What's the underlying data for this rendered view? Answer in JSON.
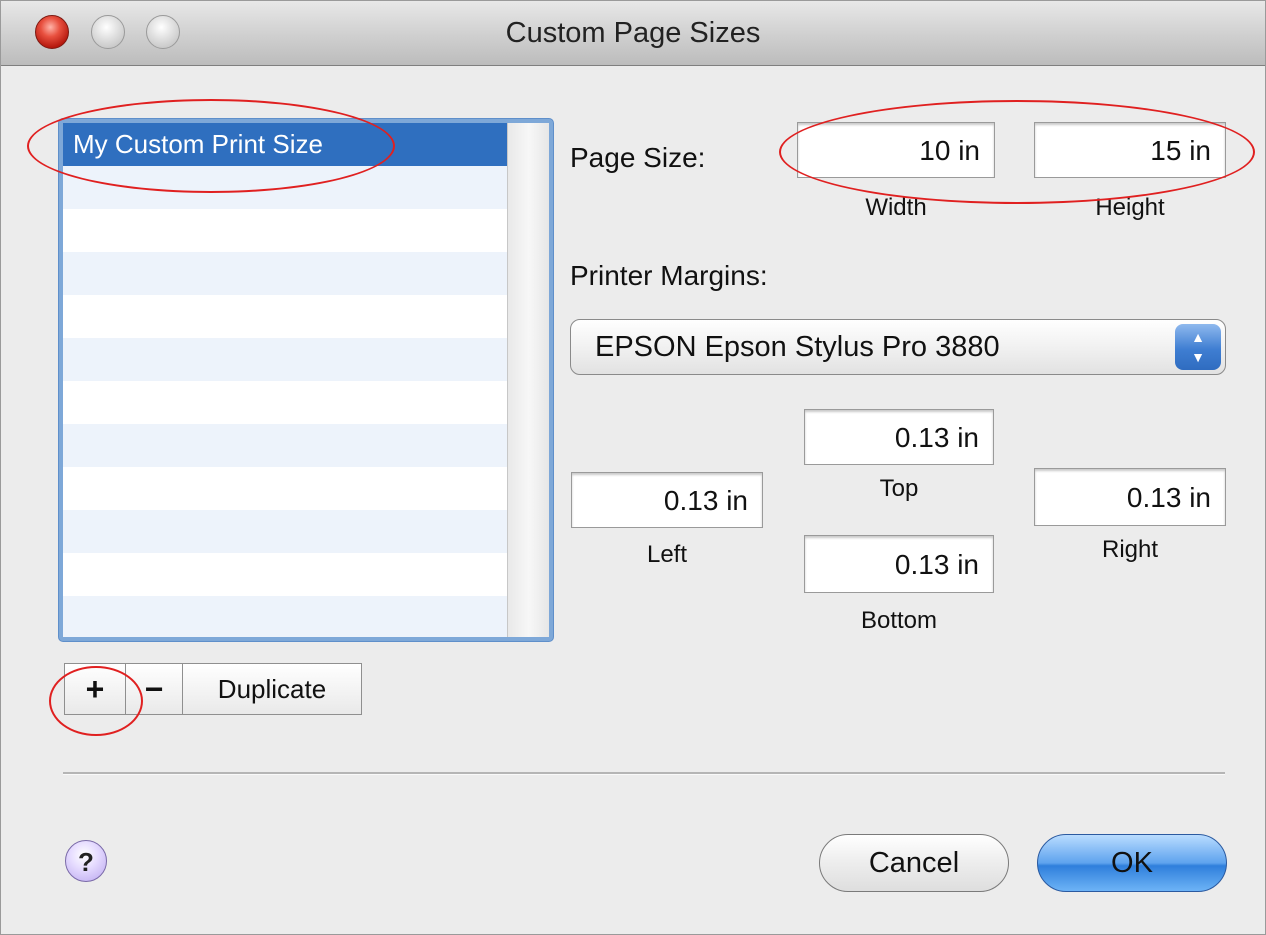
{
  "window": {
    "title": "Custom Page Sizes"
  },
  "list": {
    "items": [
      "My Custom Print Size"
    ]
  },
  "list_buttons": {
    "add": "+",
    "remove": "−",
    "duplicate": "Duplicate"
  },
  "page_size": {
    "label": "Page Size:",
    "width_value": "10 in",
    "width_caption": "Width",
    "height_value": "15 in",
    "height_caption": "Height"
  },
  "printer_margins": {
    "label": "Printer Margins:",
    "printer": "EPSON Epson Stylus Pro 3880",
    "top_value": "0.13 in",
    "top_caption": "Top",
    "left_value": "0.13 in",
    "left_caption": "Left",
    "right_value": "0.13 in",
    "right_caption": "Right",
    "bottom_value": "0.13 in",
    "bottom_caption": "Bottom"
  },
  "footer": {
    "help": "?",
    "cancel": "Cancel",
    "ok": "OK"
  },
  "colors": {
    "selection": "#2f6fbf",
    "annotation": "#e02020",
    "default_button": "#5ea3ee"
  }
}
